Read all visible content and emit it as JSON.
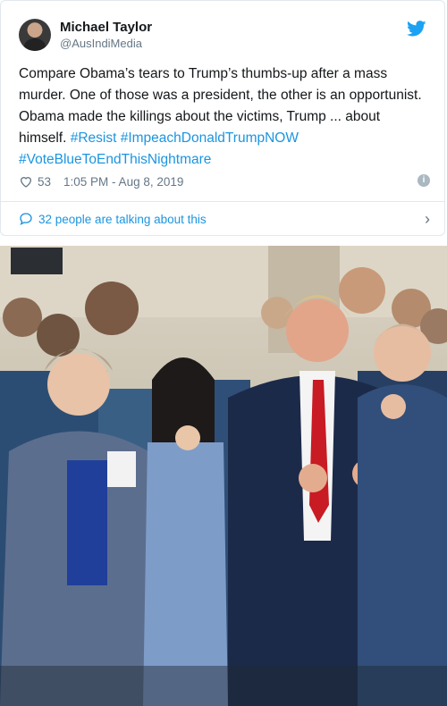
{
  "tweet": {
    "author_name": "Michael Taylor",
    "author_handle": "@AusIndiMedia",
    "text_plain": "Compare Obama’s tears to Trump’s thumbs-up after a mass murder. One of those was a president, the other is an opportunist. Obama made the killings about the victims, Trump ... about himself. ",
    "hashtags": [
      "#Resist",
      "#ImpeachDonaldTrumpNOW",
      "#VoteBlueToEndThisNightmare"
    ],
    "likes": "53",
    "timestamp": "1:05 PM - Aug 8, 2019",
    "talking_label": "32 people are talking about this"
  },
  "icons": {
    "platform": "twitter-bird-icon",
    "like": "heart-icon",
    "info": "info-icon",
    "conversation": "speech-bubble-icon",
    "chevron": "chevron-right-icon"
  },
  "colors": {
    "link": "#1b95e0",
    "secondary_text": "#657786",
    "border": "#e1e8ed",
    "twitter_blue": "#1da1f2"
  }
}
